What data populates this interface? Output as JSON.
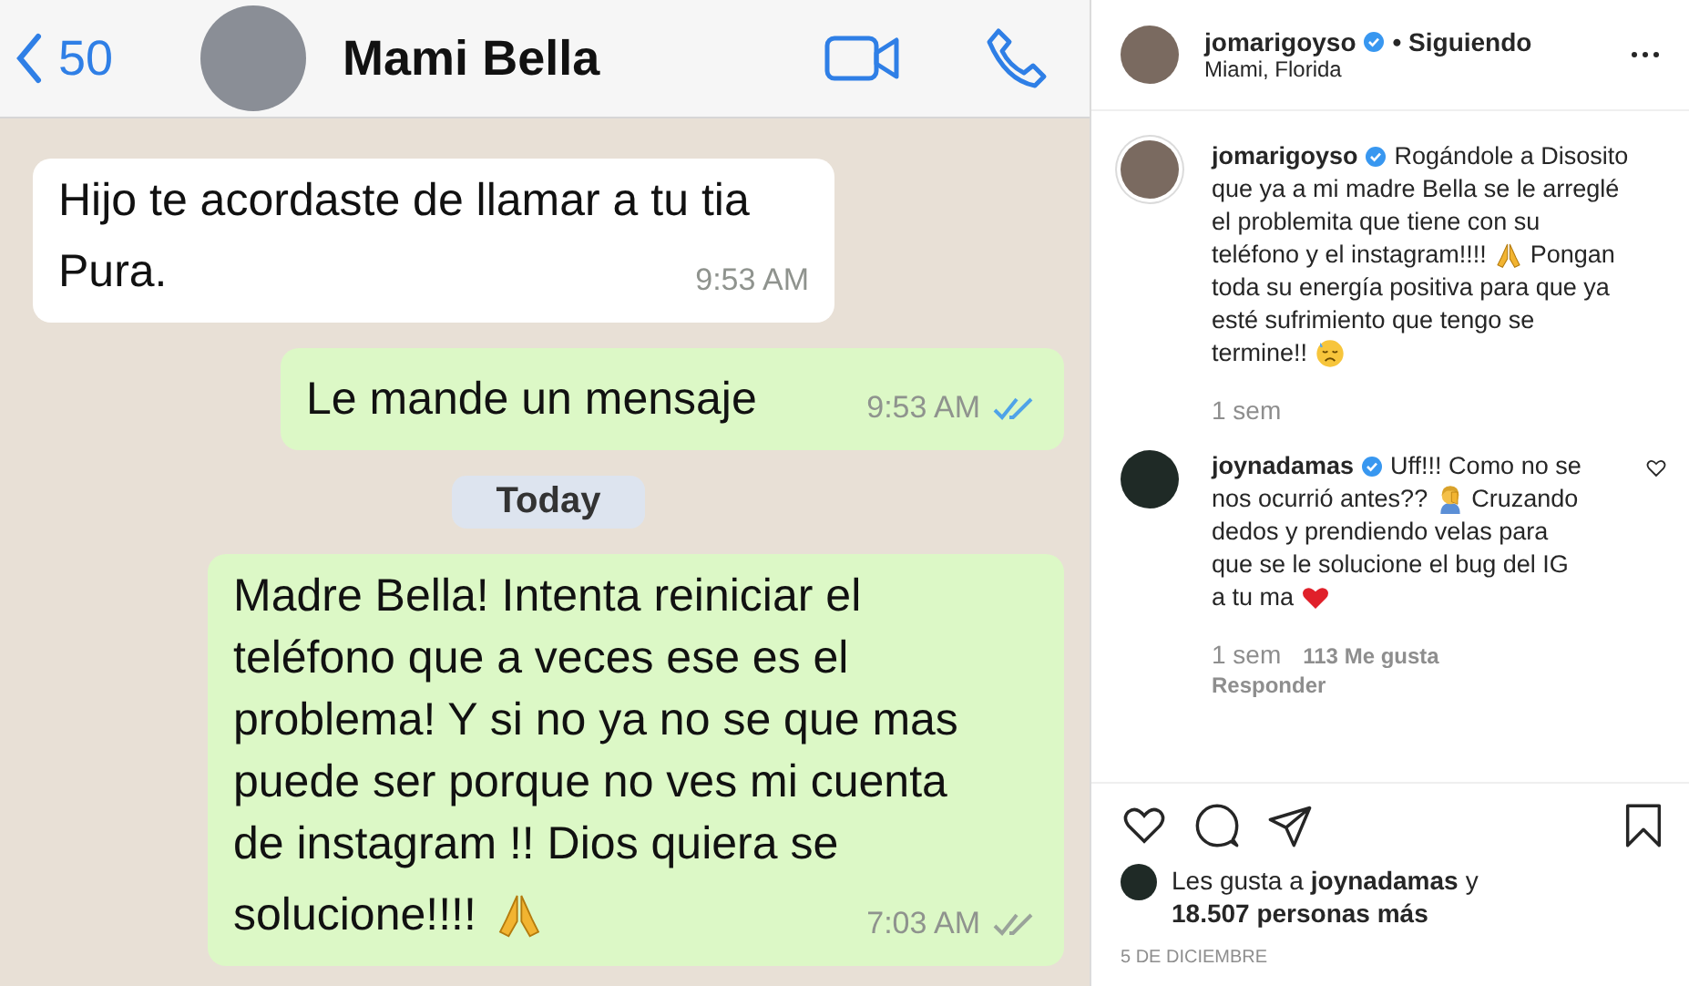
{
  "chat": {
    "back_count": "50",
    "contact_name": "Mami Bella",
    "messages": [
      {
        "kind": "incoming",
        "lines": [
          [
            {
              "kind": "text",
              "text": "Hijo te acordaste de llamar a tu tia"
            }
          ],
          [
            {
              "kind": "text",
              "text": "Pura."
            }
          ]
        ],
        "time": "9:53 AM"
      },
      {
        "kind": "outgoing",
        "lines": [
          [
            {
              "kind": "text",
              "text": "Le mande un mensaje"
            }
          ]
        ],
        "time": "9:53 AM",
        "read": true
      },
      {
        "kind": "date",
        "text": "Today"
      },
      {
        "kind": "outgoing",
        "lines": [
          [
            {
              "kind": "text",
              "text": "Madre Bella! Intenta reiniciar el"
            }
          ],
          [
            {
              "kind": "text",
              "text": "teléfono que a veces ese es el"
            }
          ],
          [
            {
              "kind": "text",
              "text": "problema! Y si no ya no se que mas"
            }
          ],
          [
            {
              "kind": "text",
              "text": "puede ser porque no ves mi cuenta"
            }
          ],
          [
            {
              "kind": "text",
              "text": "de instagram !! Dios quiera se"
            }
          ],
          [
            {
              "kind": "text",
              "text": "solucione!!!!"
            },
            {
              "kind": "pray"
            }
          ]
        ],
        "time": "7:03 AM",
        "read": false
      }
    ]
  },
  "post": {
    "username": "jomarigoyso",
    "verified": true,
    "follow_status": "• Siguiendo",
    "location": "Miami, Florida",
    "comments": [
      {
        "username": "jomarigoyso",
        "verified": true,
        "lines": [
          [
            {
              "kind": "text",
              "text": "Rogándole a Disosito"
            }
          ],
          [
            {
              "kind": "text",
              "text": "que ya a mi madre Bella se le arreglé"
            }
          ],
          [
            {
              "kind": "text",
              "text": "el problemita que tiene con su"
            }
          ],
          [
            {
              "kind": "text",
              "text": "teléfono y el instagram!!!!"
            },
            {
              "kind": "pray"
            },
            {
              "kind": "text",
              "text": "Pongan"
            }
          ],
          [
            {
              "kind": "text",
              "text": "toda su energía positiva para que ya"
            }
          ],
          [
            {
              "kind": "text",
              "text": "esté sufrimiento que tengo se"
            }
          ],
          [
            {
              "kind": "text",
              "text": "termine!!"
            },
            {
              "kind": "sad"
            }
          ]
        ],
        "age": "1 sem",
        "has_like_button": false
      },
      {
        "username": "joynadamas",
        "verified": true,
        "lines": [
          [
            {
              "kind": "text",
              "text": "Uff!!! Como no se"
            }
          ],
          [
            {
              "kind": "text",
              "text": "nos ocurrió antes??"
            },
            {
              "kind": "facepalm"
            },
            {
              "kind": "text",
              "text": "Cruzando"
            }
          ],
          [
            {
              "kind": "text",
              "text": "dedos y prendiendo velas para"
            }
          ],
          [
            {
              "kind": "text",
              "text": "que se le solucione el bug del IG"
            }
          ],
          [
            {
              "kind": "text",
              "text": "a tu ma"
            },
            {
              "kind": "heart"
            }
          ]
        ],
        "age": "1 sem",
        "likes": "113 Me gusta",
        "reply": "Responder",
        "has_like_button": true
      }
    ],
    "liked": false,
    "saved": false,
    "likes_prefix": "Les gusta a",
    "likes_user": "joynadamas",
    "likes_mid": "y",
    "likes_count": "18.507 personas más",
    "date": "5 DE DICIEMBRE"
  }
}
